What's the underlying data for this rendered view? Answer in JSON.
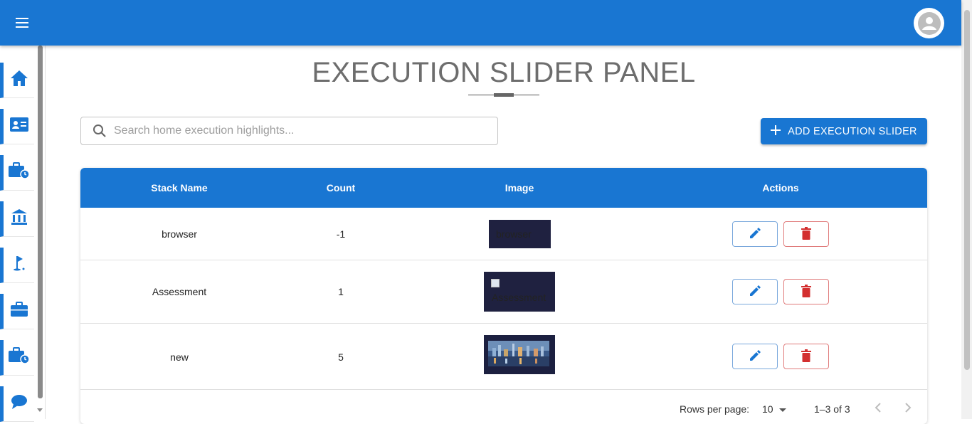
{
  "app": {
    "menu_icon": "hamburger-menu-icon",
    "avatar_icon": "account-circle-icon"
  },
  "sidebar": {
    "items": [
      {
        "icon": "home-icon"
      },
      {
        "icon": "contact-card-icon"
      },
      {
        "icon": "briefcase-clock-icon"
      },
      {
        "icon": "bank-icon"
      },
      {
        "icon": "golf-flag-icon"
      },
      {
        "icon": "briefcase-icon"
      },
      {
        "icon": "briefcase-clock-icon"
      },
      {
        "icon": "chat-bubble-icon"
      }
    ]
  },
  "page": {
    "title": "EXECUTION SLIDER PANEL"
  },
  "search": {
    "placeholder": "Search home execution highlights..."
  },
  "toolbar": {
    "add_label": "ADD EXECUTION SLIDER"
  },
  "table": {
    "headers": [
      "Stack Name",
      "Count",
      "Image",
      "Actions"
    ],
    "rows": [
      {
        "name": "browser",
        "count": "-1",
        "image_alt": "browser"
      },
      {
        "name": "Assessment",
        "count": "1",
        "image_alt": "Assessment"
      },
      {
        "name": "new",
        "count": "5",
        "image_alt": ""
      }
    ]
  },
  "pagination": {
    "rows_per_page_label": "Rows per page:",
    "rows_per_page_value": "10",
    "range": "1–3 of 3"
  },
  "colors": {
    "primary": "#1976d2",
    "danger": "#d32f2f"
  }
}
